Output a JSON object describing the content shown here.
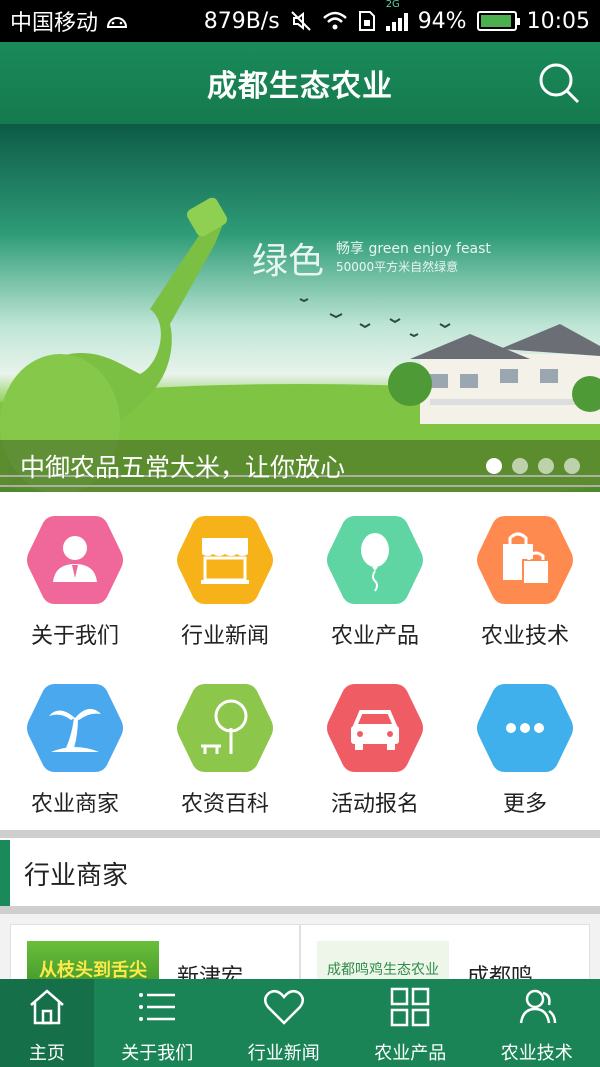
{
  "status_bar": {
    "carrier": "中国移动",
    "speed": "879B/s",
    "network": "2G",
    "battery": "94%",
    "battery_level": 0.94,
    "time": "10:05"
  },
  "header": {
    "title": "成都生态农业"
  },
  "banner": {
    "caption": "中御农品五常大米，让你放心",
    "image_text_main": "绿色",
    "image_text_sub1": "畅享 green enjoy feast",
    "image_text_sub2": "50000平方米自然绿意",
    "slide_count": 4,
    "active_slide": 1
  },
  "grid": {
    "items": [
      {
        "label": "关于我们",
        "icon": "person-icon",
        "color": "#f0689a"
      },
      {
        "label": "行业新闻",
        "icon": "shop-icon",
        "color": "#f7b21a"
      },
      {
        "label": "农业产品",
        "icon": "balloon-icon",
        "color": "#5fd5a4"
      },
      {
        "label": "农业技术",
        "icon": "shopping-bag-icon",
        "color": "#ff8a50"
      },
      {
        "label": "农业商家",
        "icon": "palm-tree-icon",
        "color": "#4aa8ee"
      },
      {
        "label": "农资百科",
        "icon": "tree-bench-icon",
        "color": "#8cc64a"
      },
      {
        "label": "活动报名",
        "icon": "car-icon",
        "color": "#f05c64"
      },
      {
        "label": "更多",
        "icon": "more-icon",
        "color": "#3fb0ec"
      }
    ]
  },
  "section": {
    "title": "行业商家"
  },
  "merchants": [
    {
      "name": "新津宏...",
      "thumb_text": "从枝头到舌尖"
    },
    {
      "name": "成都鸣...",
      "thumb_text": "成都鸣鸡生态农业"
    }
  ],
  "bottom_nav": {
    "items": [
      {
        "label": "主页",
        "icon": "home-icon",
        "active": true
      },
      {
        "label": "关于我们",
        "icon": "list-icon",
        "active": false
      },
      {
        "label": "行业新闻",
        "icon": "heart-icon",
        "active": false
      },
      {
        "label": "农业产品",
        "icon": "grid-icon",
        "active": false
      },
      {
        "label": "农业技术",
        "icon": "users-icon",
        "active": false
      }
    ]
  },
  "colors": {
    "primary_green": "#1a8a5a",
    "nav_green": "#1b8457",
    "nav_active": "#15704a"
  }
}
